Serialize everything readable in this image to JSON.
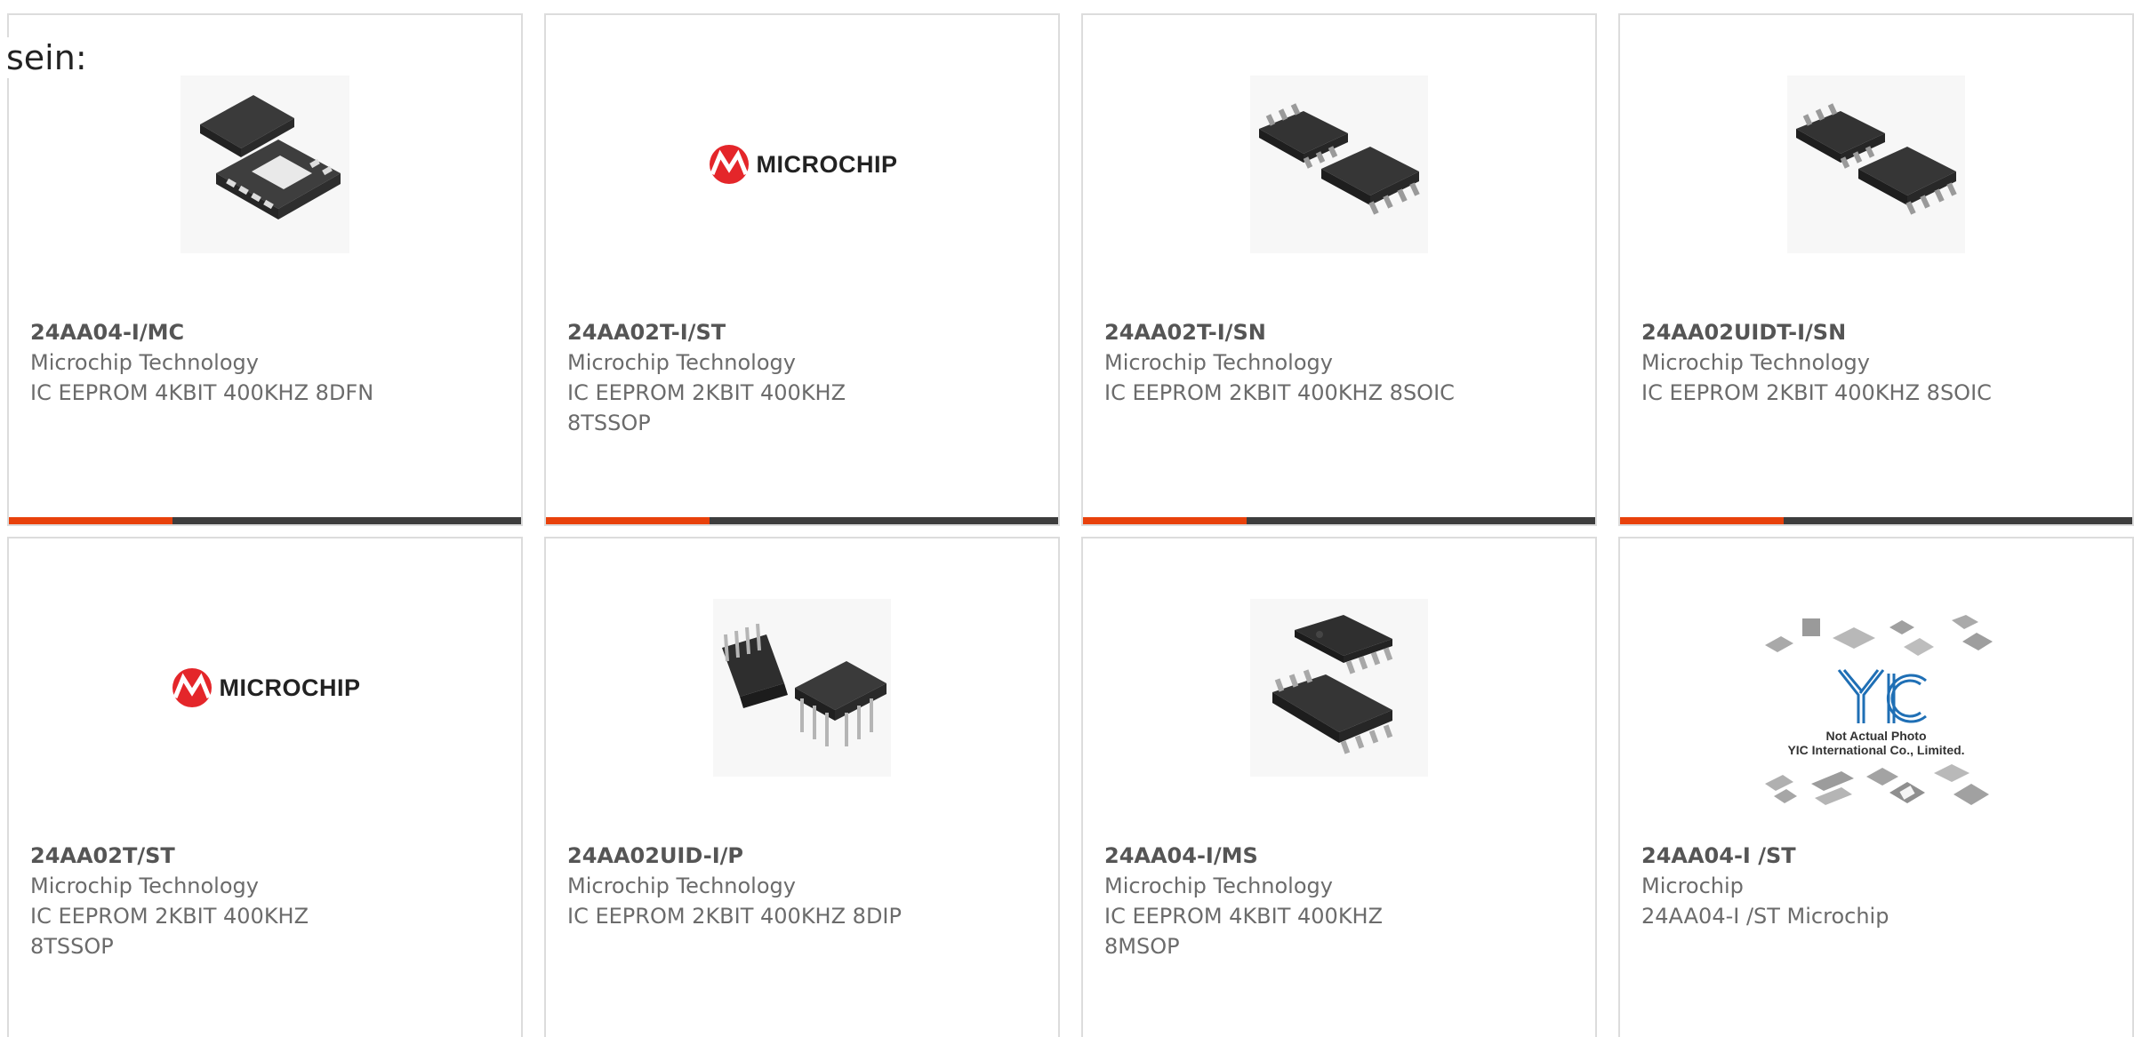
{
  "overlay_label": "sein:",
  "colors": {
    "accent": "#e8410b",
    "bar": "#3d3d3d",
    "card_border": "#dcdcdc",
    "text": "#6b6b6b",
    "microchip_red": "#e4262a",
    "yic_blue": "#1f6fb5"
  },
  "products": [
    {
      "part_number": "24AA04-I/MC",
      "manufacturer": "Microchip Technology",
      "description": "IC EEPROM 4KBIT 400KHZ 8DFN",
      "image": "dfn-package-icon"
    },
    {
      "part_number": "24AA02T-I/ST",
      "manufacturer": "Microchip Technology",
      "description": "IC EEPROM 2KBIT 400KHZ 8TSSOP",
      "image": "microchip-logo",
      "logo_text": "MICROCHIP"
    },
    {
      "part_number": "24AA02T-I/SN",
      "manufacturer": "Microchip Technology",
      "description": "IC EEPROM 2KBIT 400KHZ 8SOIC",
      "image": "soic-package-icon"
    },
    {
      "part_number": "24AA02UIDT-I/SN",
      "manufacturer": "Microchip Technology",
      "description": "IC EEPROM 2KBIT 400KHZ 8SOIC",
      "image": "soic-package-icon"
    },
    {
      "part_number": "24AA02T/ST",
      "manufacturer": "Microchip Technology",
      "description": "IC EEPROM 2KBIT 400KHZ 8TSSOP",
      "image": "microchip-logo",
      "logo_text": "MICROCHIP"
    },
    {
      "part_number": "24AA02UID-I/P",
      "manufacturer": "Microchip Technology",
      "description": "IC EEPROM 2KBIT 400KHZ 8DIP",
      "image": "dip-package-icon"
    },
    {
      "part_number": "24AA04-I/MS",
      "manufacturer": "Microchip Technology",
      "description": "IC EEPROM 4KBIT 400KHZ 8MSOP",
      "image": "msop-package-icon"
    },
    {
      "part_number": "24AA04-I /ST",
      "manufacturer": "Microchip",
      "description": "24AA04-I /ST Microchip",
      "image": "yic-placeholder",
      "placeholder_line1": "Not Actual Photo",
      "placeholder_line2": "YIC International Co., Limited."
    }
  ]
}
